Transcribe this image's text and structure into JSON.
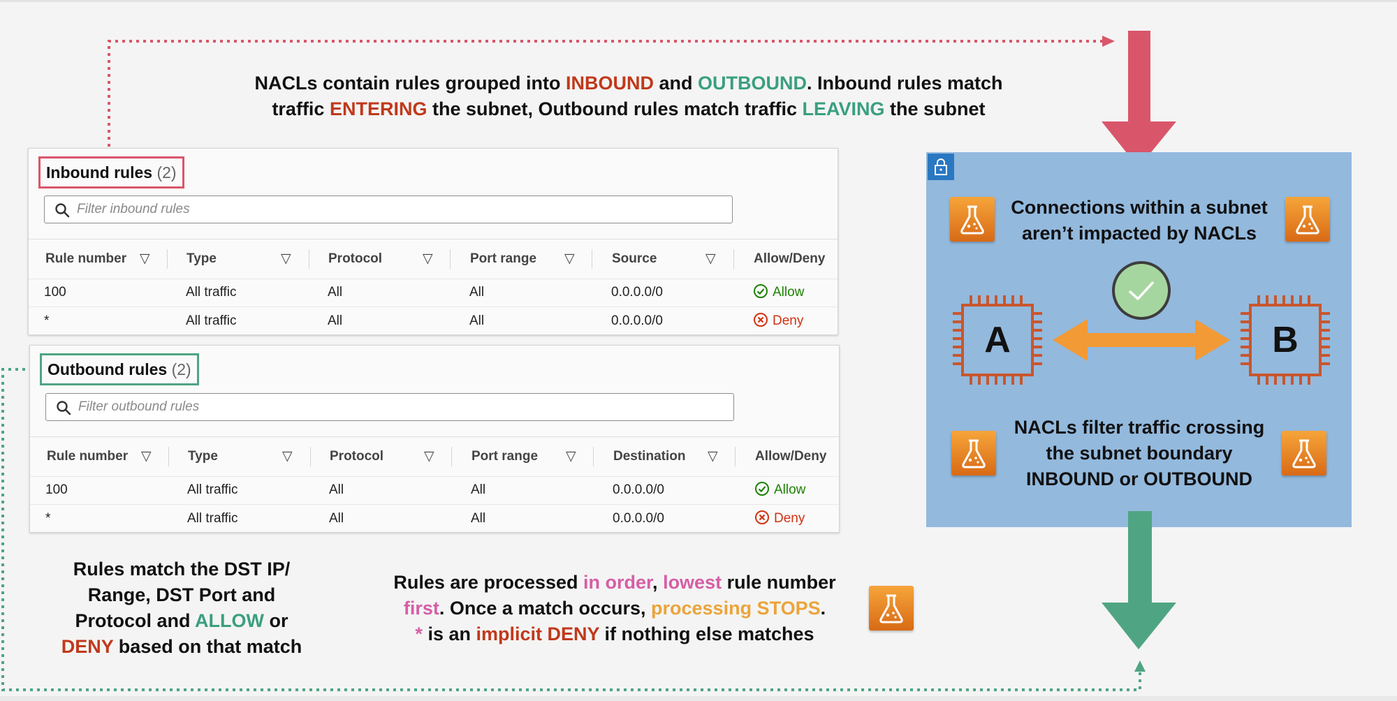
{
  "header": {
    "parts": [
      {
        "text": "NACLs contain rules grouped into ",
        "color": "#111111"
      },
      {
        "text": "INBOUND",
        "color": "#c0391b"
      },
      {
        "text": " and ",
        "color": "#111111"
      },
      {
        "text": "OUTBOUND",
        "color": "#3a9f7f"
      },
      {
        "text": ". Inbound rules match",
        "color": "#111111"
      }
    ],
    "parts2": [
      {
        "text": "traffic ",
        "color": "#111111"
      },
      {
        "text": "ENTERING",
        "color": "#c0391b"
      },
      {
        "text": " the subnet, Outbound rules match traffic ",
        "color": "#111111"
      },
      {
        "text": "LEAVING",
        "color": "#3a9f7f"
      },
      {
        "text": " the subnet",
        "color": "#111111"
      }
    ]
  },
  "inbound": {
    "title": "Inbound rules",
    "count": "(2)",
    "filter_placeholder": "Filter inbound rules",
    "columns": [
      "Rule number",
      "Type",
      "Protocol",
      "Port range",
      "Source",
      "Allow/Deny"
    ],
    "rows": [
      {
        "rule": "100",
        "type": "All traffic",
        "protocol": "All",
        "port": "All",
        "addr": "0.0.0.0/0",
        "action": "Allow"
      },
      {
        "rule": "*",
        "type": "All traffic",
        "protocol": "All",
        "port": "All",
        "addr": "0.0.0.0/0",
        "action": "Deny"
      }
    ]
  },
  "outbound": {
    "title": "Outbound rules",
    "count": "(2)",
    "filter_placeholder": "Filter outbound rules",
    "columns": [
      "Rule number",
      "Type",
      "Protocol",
      "Port range",
      "Destination",
      "Allow/Deny"
    ],
    "rows": [
      {
        "rule": "100",
        "type": "All traffic",
        "protocol": "All",
        "port": "All",
        "addr": "0.0.0.0/0",
        "action": "Allow"
      },
      {
        "rule": "*",
        "type": "All traffic",
        "protocol": "All",
        "port": "All",
        "addr": "0.0.0.0/0",
        "action": "Deny"
      }
    ]
  },
  "notes": {
    "left_lines": [
      [
        {
          "text": "Rules match the DST IP/",
          "color": "#111111"
        }
      ],
      [
        {
          "text": "Range, DST Port and",
          "color": "#111111"
        }
      ],
      [
        {
          "text": "Protocol and ",
          "color": "#111111"
        },
        {
          "text": "ALLOW",
          "color": "#3a9f7f"
        },
        {
          "text": " or",
          "color": "#111111"
        }
      ],
      [
        {
          "text": "DENY",
          "color": "#c0391b"
        },
        {
          "text": " based on that match",
          "color": "#111111"
        }
      ]
    ],
    "middle_lines": [
      [
        {
          "text": "Rules are processed ",
          "color": "#111111"
        },
        {
          "text": "in order",
          "color": "#d65ea6"
        },
        {
          "text": ", ",
          "color": "#111111"
        },
        {
          "text": "lowest",
          "color": "#d65ea6"
        },
        {
          "text": " rule number",
          "color": "#111111"
        }
      ],
      [
        {
          "text": "first",
          "color": "#d65ea6"
        },
        {
          "text": ". Once a match occurs, ",
          "color": "#111111"
        },
        {
          "text": "processing STOPS",
          "color": "#eba43a"
        },
        {
          "text": ".",
          "color": "#111111"
        }
      ],
      [
        {
          "text": "*",
          "color": "#d65ea6"
        },
        {
          "text": " is an ",
          "color": "#111111"
        },
        {
          "text": "implicit DENY",
          "color": "#c0391b"
        },
        {
          "text": " if nothing else matches",
          "color": "#111111"
        }
      ]
    ]
  },
  "diagram": {
    "top_text": [
      "Connections within a subnet",
      "aren’t impacted by NACLs"
    ],
    "bottom_text": [
      "NACLs filter traffic crossing",
      "the subnet boundary",
      "INBOUND or OUTBOUND"
    ],
    "node_a": "A",
    "node_b": "B",
    "colors": {
      "subnet_fill": "#93b9dd",
      "inbound_arrow": "#d9566a",
      "outbound_arrow": "#4fa583",
      "chip_outline": "#c9562d",
      "bidirectional_arrow": "#f29a35",
      "check_circle": "#a6d6a0"
    }
  },
  "icons": [
    "search-icon",
    "check-circle-icon",
    "x-circle-icon",
    "lock-icon",
    "flask-icon",
    "sort-caret-icon",
    "chip-icon",
    "checkmark-icon"
  ]
}
